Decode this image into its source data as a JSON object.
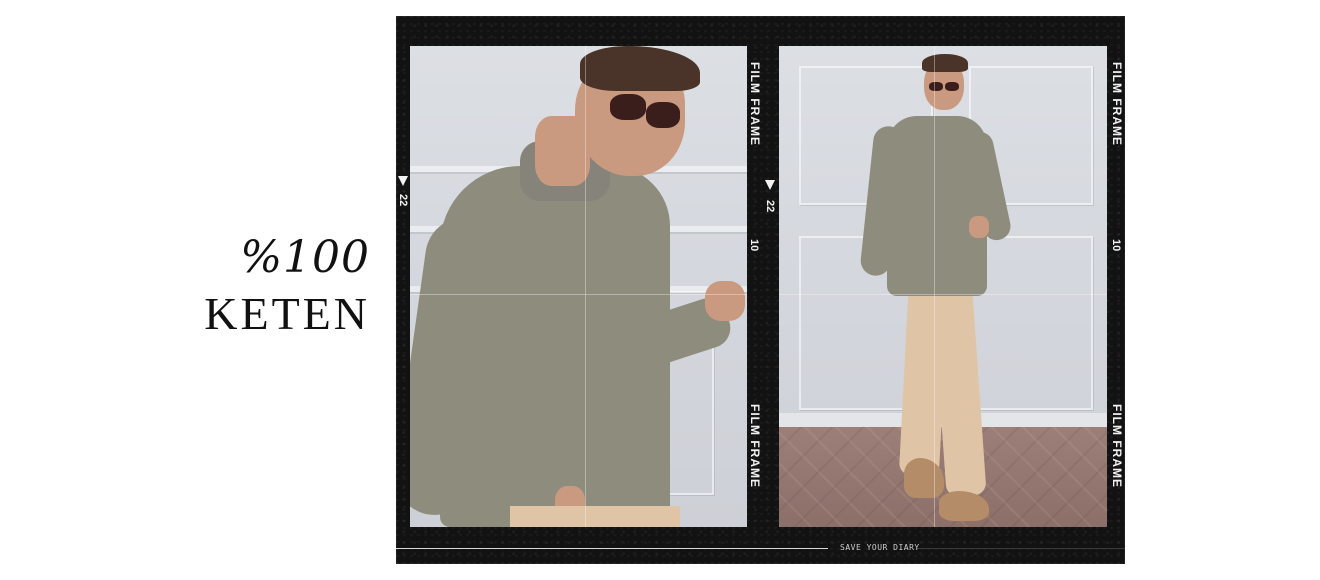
{
  "headline": {
    "percent": "%100",
    "word": "KETEN"
  },
  "film": {
    "frame_label": "FILM FRAME",
    "frame_number": "22",
    "frame_counter": "10",
    "caption": "SAVE YOUR DIARY"
  },
  "colors": {
    "film_black": "#121212",
    "shirt_sage": "#8e8c7d",
    "trouser_beige": "#dfc4a6",
    "wall_grey": "#d6d9de"
  }
}
